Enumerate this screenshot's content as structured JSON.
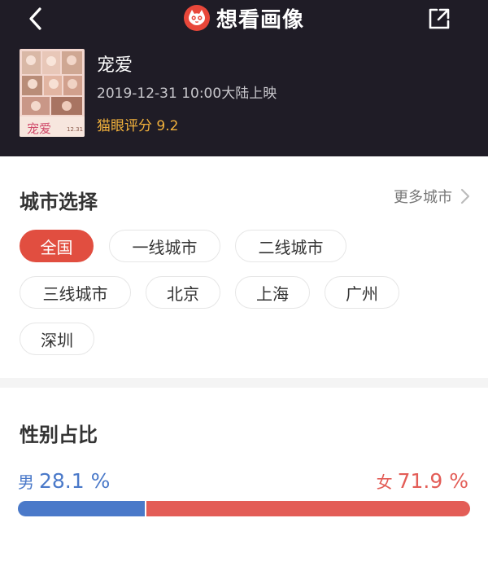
{
  "nav": {
    "title": "想看画像",
    "back_icon": "chevron-left-icon",
    "share_icon": "share-external-icon",
    "logo_icon": "maoyan-cat-logo"
  },
  "movie": {
    "title": "宠爱",
    "release": "2019-12-31 10:00大陆上映",
    "rating": "猫眼评分 9.2",
    "poster_title": "宠爱",
    "poster_date": "12.31"
  },
  "city": {
    "title": "城市选择",
    "more": "更多城市",
    "chips": [
      {
        "label": "全国",
        "active": true
      },
      {
        "label": "一线城市",
        "active": false
      },
      {
        "label": "二线城市",
        "active": false
      },
      {
        "label": "三线城市",
        "active": false
      },
      {
        "label": "北京",
        "active": false
      },
      {
        "label": "上海",
        "active": false
      },
      {
        "label": "广州",
        "active": false
      },
      {
        "label": "深圳",
        "active": false
      }
    ]
  },
  "gender": {
    "title": "性别占比",
    "male_label": "男",
    "male_value": "28.1 %",
    "male_pct": 28.1,
    "female_label": "女",
    "female_value": "71.9 %",
    "female_pct": 71.9
  },
  "colors": {
    "header_bg": "#1f1c26",
    "accent_red": "#e14e40",
    "rating_gold": "#f2b13c",
    "male_blue": "#4a79c9",
    "female_red": "#e35d57"
  }
}
